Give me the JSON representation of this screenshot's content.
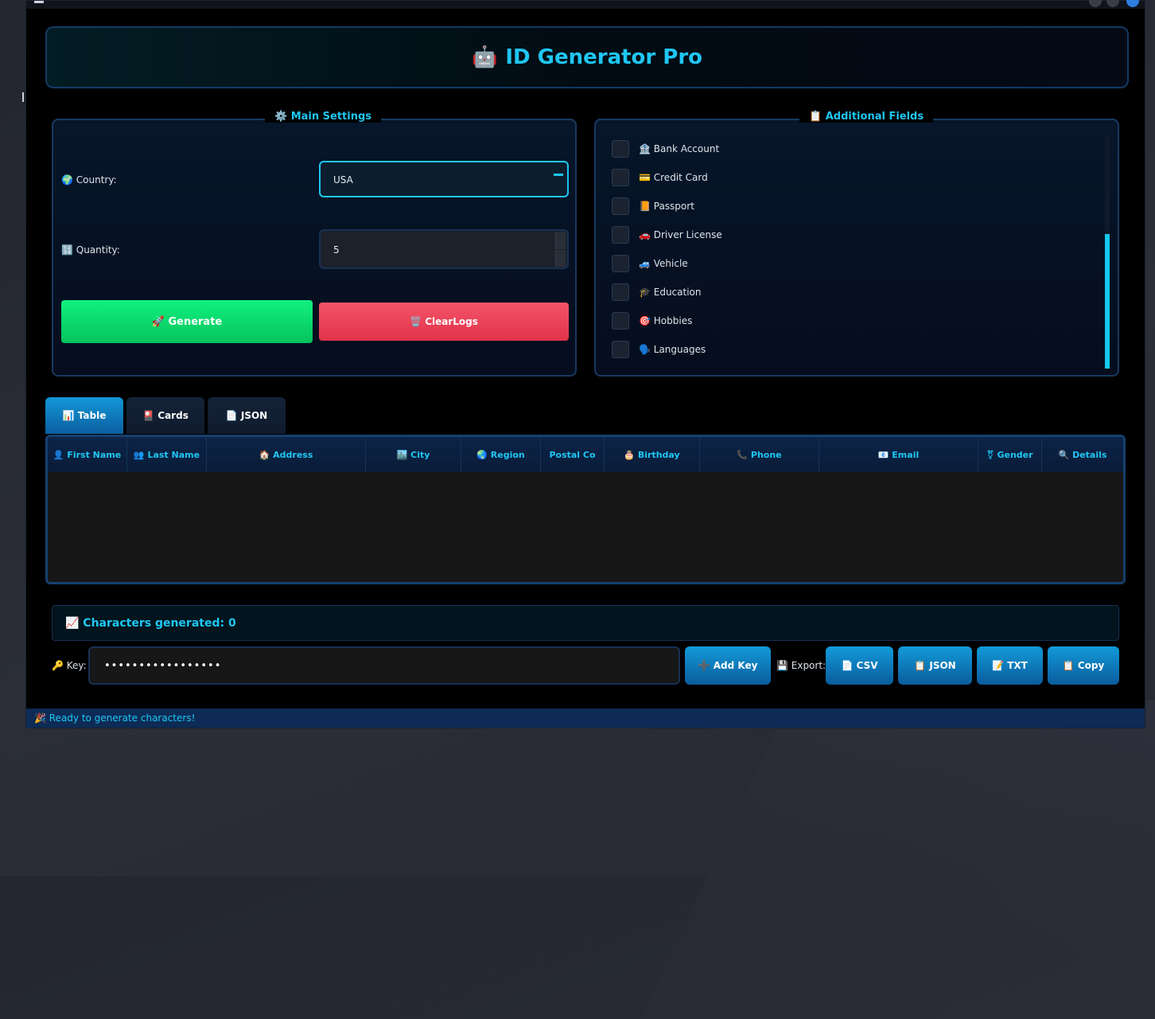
{
  "header": {
    "icon": "🤖",
    "title": "ID Generator Pro"
  },
  "main_settings": {
    "title": "⚙️ Main Settings",
    "country_label": "🌍 Country:",
    "country_value": "USA",
    "quantity_label": "🔢 Quantity:",
    "quantity_value": "5",
    "generate_label": "🚀 Generate",
    "clear_label": "🗑️ ClearLogs"
  },
  "additional_fields": {
    "title": "📋 Additional Fields",
    "items": [
      {
        "label": "🏦 Bank Account"
      },
      {
        "label": "💳 Credit Card"
      },
      {
        "label": "📙 Passport"
      },
      {
        "label": "🚗 Driver License"
      },
      {
        "label": "🚙 Vehicle"
      },
      {
        "label": "🎓 Education"
      },
      {
        "label": "🎯 Hobbies"
      },
      {
        "label": "🗣️ Languages"
      }
    ]
  },
  "tabs": [
    {
      "label": "📊 Table",
      "active": true
    },
    {
      "label": "🎴 Cards",
      "active": false
    },
    {
      "label": "📄 JSON",
      "active": false
    }
  ],
  "table": {
    "columns": [
      "👤 First Name",
      "👥 Last Name",
      "🏠 Address",
      "🏙️ City",
      "🌏 Region",
      "Postal Co",
      "🎂 Birthday",
      "📞 Phone",
      "📧 Email",
      "⚧ Gender",
      "🔍 Details"
    ],
    "rows": []
  },
  "stats": {
    "text": "📈 Characters generated: 0"
  },
  "key": {
    "label": "🔑 Key:",
    "value": "•••••••••••••••••"
  },
  "buttons": {
    "add_key": "➕ Add Key",
    "export_label": "💾 Export:",
    "csv": "📄 CSV",
    "json": "📋 JSON",
    "txt": "📝 TXT",
    "copy": "📋 Copy"
  },
  "status": {
    "text": "🎉 Ready to generate characters!"
  },
  "colors": {
    "accent": "#1fc6f2",
    "generate": "#0ad86c",
    "clear": "#ea4055",
    "button_blue": "#0f7fc0",
    "background": "#000000"
  }
}
